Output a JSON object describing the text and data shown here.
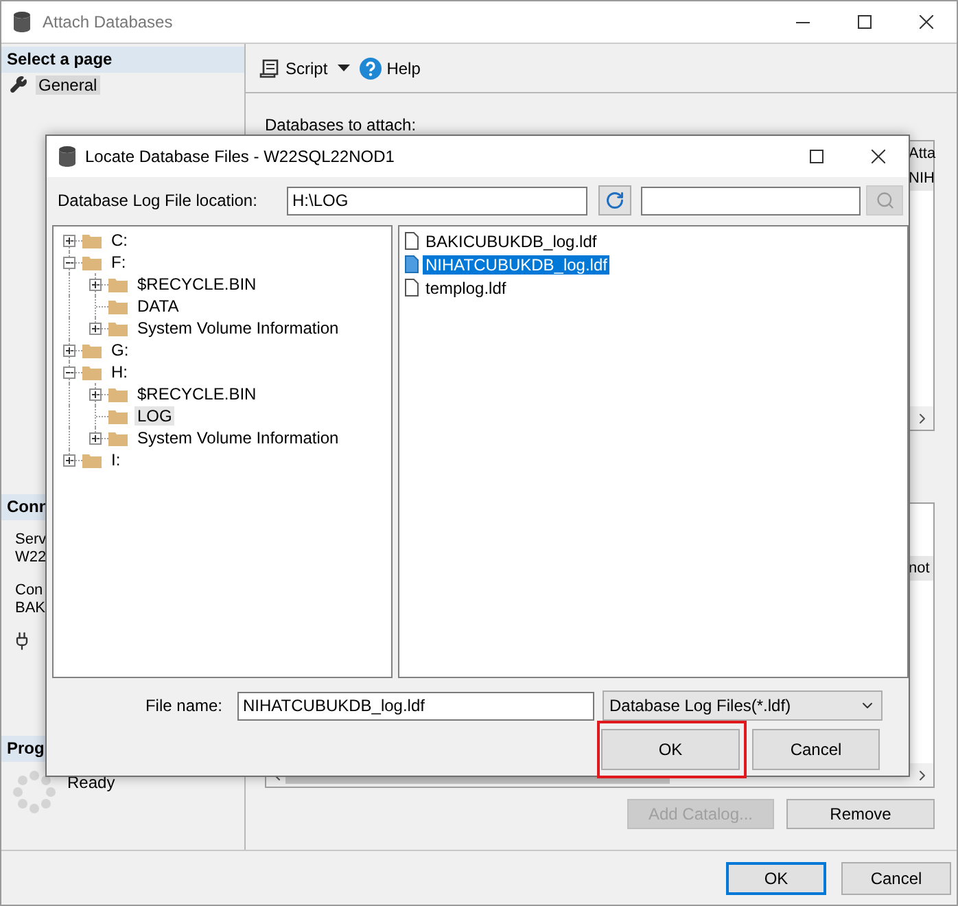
{
  "window": {
    "title": "Attach Databases"
  },
  "sidebar": {
    "header": "Select a page",
    "items": [
      {
        "label": "General",
        "selected": true
      }
    ],
    "connection": {
      "header": "Conn",
      "lines": [
        "Serv",
        "W22",
        "Con",
        "BAK"
      ]
    },
    "progress": {
      "header": "Prog",
      "status": "Ready"
    }
  },
  "toolbar": {
    "items": [
      {
        "kind": "script",
        "label": "Script"
      },
      {
        "kind": "help",
        "label": "Help"
      }
    ]
  },
  "content": {
    "label": "Databases to attach:",
    "top_grid": {
      "header": "Atta",
      "rows": [
        "NIH"
      ]
    },
    "bottom_grid": {
      "rows": [
        "not"
      ]
    },
    "buttons": [
      {
        "label": "Add Catalog...",
        "disabled": true
      },
      {
        "label": "Remove",
        "disabled": false
      }
    ]
  },
  "footer": {
    "buttons": [
      {
        "label": "OK",
        "default": true
      },
      {
        "label": "Cancel",
        "default": false
      }
    ]
  },
  "dialog": {
    "title": "Locate Database Files - W22SQL22NOD1",
    "location_label": "Database Log File location:",
    "location_value": "H:\\LOG",
    "tree": [
      {
        "label": "C:",
        "expandable": true,
        "expanded": false,
        "selected": false
      },
      {
        "label": "F:",
        "expandable": true,
        "expanded": true,
        "selected": false,
        "children": [
          {
            "label": "$RECYCLE.BIN",
            "expandable": true,
            "expanded": false,
            "selected": false
          },
          {
            "label": "DATA",
            "expandable": false,
            "selected": false
          },
          {
            "label": "System Volume Information",
            "expandable": true,
            "expanded": false,
            "selected": false
          }
        ]
      },
      {
        "label": "G:",
        "expandable": true,
        "expanded": false,
        "selected": false
      },
      {
        "label": "H:",
        "expandable": true,
        "expanded": true,
        "selected": false,
        "children": [
          {
            "label": "$RECYCLE.BIN",
            "expandable": true,
            "expanded": false,
            "selected": false
          },
          {
            "label": "LOG",
            "expandable": false,
            "selected": true
          },
          {
            "label": "System Volume Information",
            "expandable": true,
            "expanded": false,
            "selected": false
          }
        ]
      },
      {
        "label": "I:",
        "expandable": true,
        "expanded": false,
        "selected": false
      }
    ],
    "files": [
      {
        "name": "BAKICUBUKDB_log.ldf",
        "selected": false
      },
      {
        "name": "NIHATCUBUKDB_log.ldf",
        "selected": true
      },
      {
        "name": "templog.ldf",
        "selected": false
      }
    ],
    "file_name_label": "File name:",
    "file_name_value": "NIHATCUBUKDB_log.ldf",
    "filter": "Database Log Files(*.ldf)",
    "buttons": [
      {
        "label": "OK",
        "highlighted": true
      },
      {
        "label": "Cancel",
        "highlighted": false
      }
    ]
  }
}
